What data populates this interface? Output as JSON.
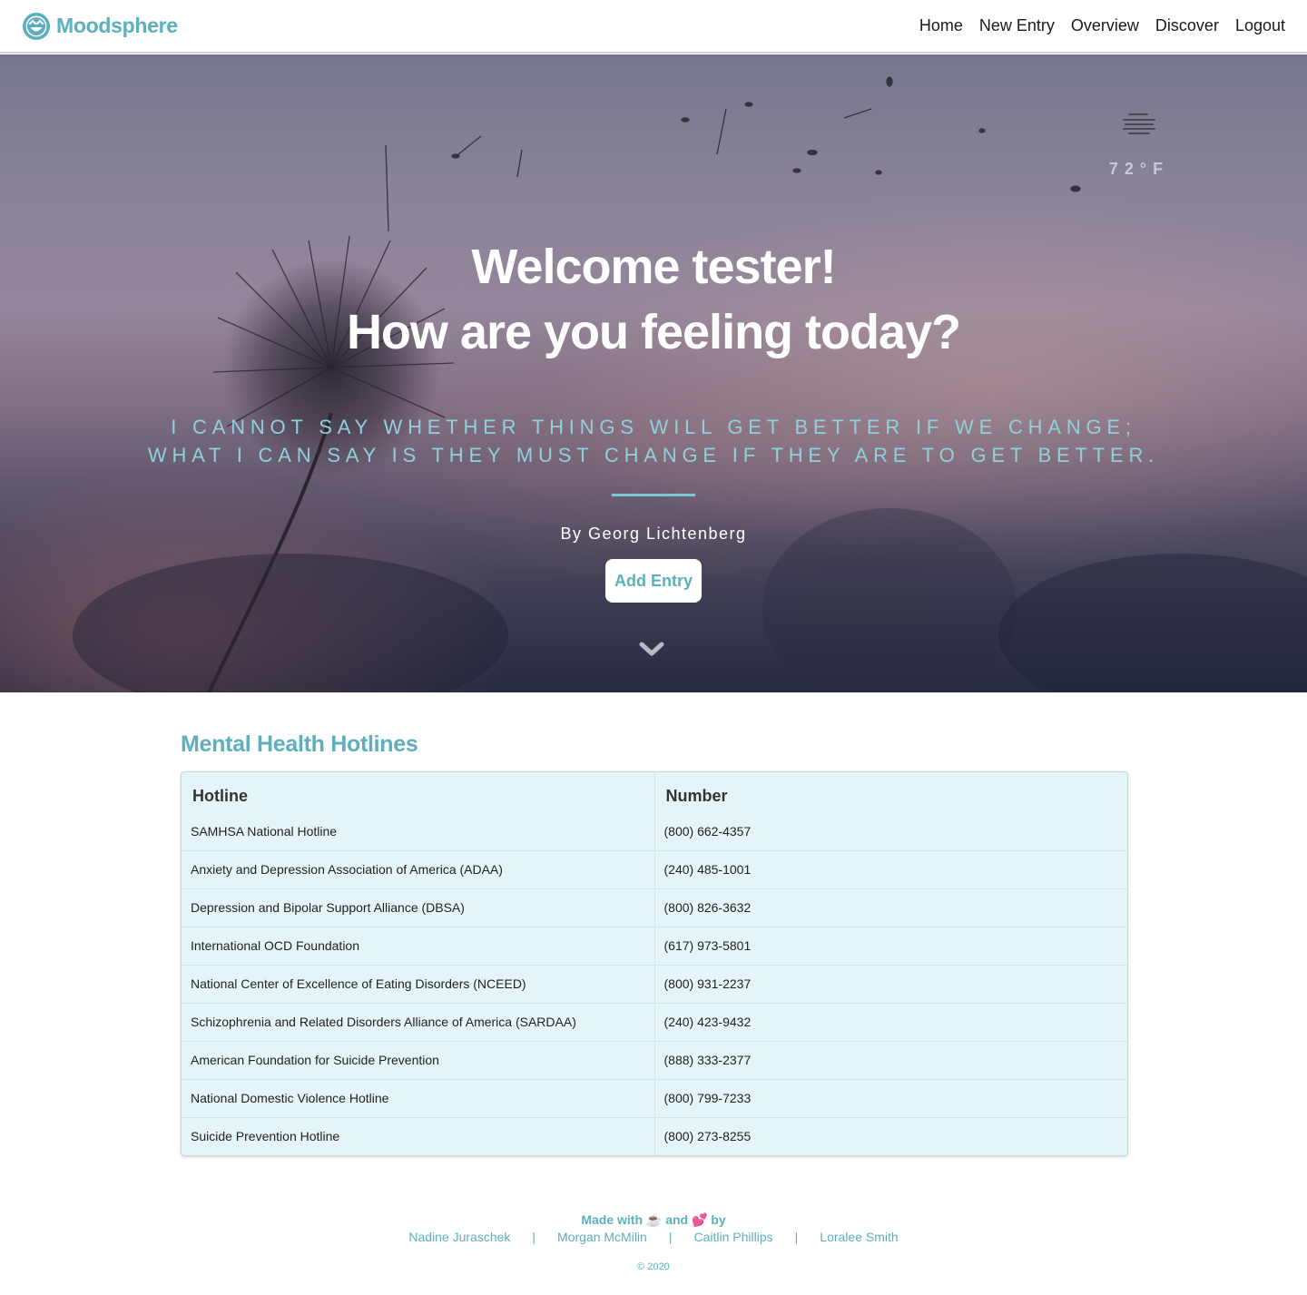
{
  "navbar": {
    "brand": "Moodsphere",
    "links": [
      "Home",
      "New Entry",
      "Overview",
      "Discover",
      "Logout"
    ]
  },
  "hero": {
    "weather": {
      "icon": "fog-icon",
      "temperature": "72°F"
    },
    "title_line1": "Welcome tester!",
    "title_line2": "How are you feeling today?",
    "quote": "I cannot say whether things will get better if we change; what I can say is they must change if they are to get better.",
    "author": "By Georg Lichtenberg",
    "add_entry_label": "Add Entry"
  },
  "hotlines": {
    "title": "Mental Health Hotlines",
    "columns": [
      "Hotline",
      "Number"
    ],
    "rows": [
      [
        "SAMHSA National Hotline",
        "(800) 662-4357"
      ],
      [
        "Anxiety and Depression Association of America (ADAA)",
        "(240) 485-1001"
      ],
      [
        "Depression and Bipolar Support Alliance (DBSA)",
        "(800) 826-3632"
      ],
      [
        "International OCD Foundation",
        "(617) 973-5801"
      ],
      [
        "National Center of Excellence of Eating Disorders (NCEED)",
        "(800) 931-2237"
      ],
      [
        "Schizophrenia and Related Disorders Alliance of America (SARDAA)",
        "(240) 423-9432"
      ],
      [
        "American Foundation for Suicide Prevention",
        "(888) 333-2377"
      ],
      [
        "National Domestic Violence Hotline",
        "(800) 799-7233"
      ],
      [
        "Suicide Prevention Hotline",
        "(800) 273-8255"
      ]
    ]
  },
  "footer": {
    "made_with": "Made with ☕ and 💕 by",
    "authors": [
      "Nadine Juraschek",
      "Morgan McMilin",
      "Caitlin Phillips",
      "Loralee Smith"
    ],
    "separator": "|",
    "copyright": "© 2020"
  },
  "colors": {
    "accent": "#5eafbd",
    "quote": "#8fd0dc",
    "table_bg": "#e5f5f7"
  }
}
